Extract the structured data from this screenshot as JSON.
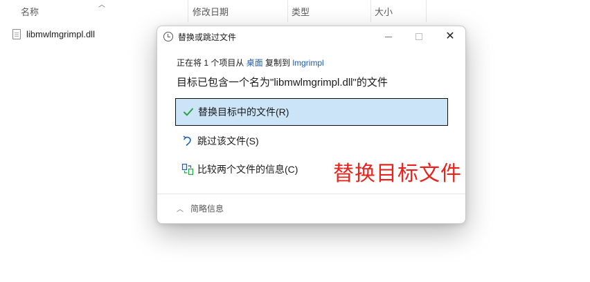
{
  "explorer": {
    "columns": {
      "name": "名称",
      "date": "修改日期",
      "type": "类型",
      "size": "大小"
    },
    "files": [
      {
        "name": "libmwlmgrimpl.dll"
      }
    ]
  },
  "dialog": {
    "title": "替换或跳过文件",
    "info": {
      "prefix": "正在将 1 个项目从 ",
      "source": "桌面",
      "middle": " 复制到 ",
      "dest": "lmgrimpl"
    },
    "headline": "目标已包含一个名为\"libmwlmgrimpl.dll\"的文件",
    "options": {
      "replace": "替换目标中的文件(R)",
      "skip": "跳过该文件(S)",
      "compare": "比较两个文件的信息(C)"
    },
    "details_label": "简略信息",
    "annotation": "替换目标文件"
  },
  "colors": {
    "selection": "#cce4f7",
    "link": "#1a5fb4",
    "annotation": "#e8231e",
    "check": "#2f9e44"
  },
  "icons": [
    "clock-icon",
    "check-icon",
    "skip-arrow-icon",
    "compare-icon",
    "chevron-up-icon",
    "sort-chevron-icon",
    "file-icon"
  ]
}
